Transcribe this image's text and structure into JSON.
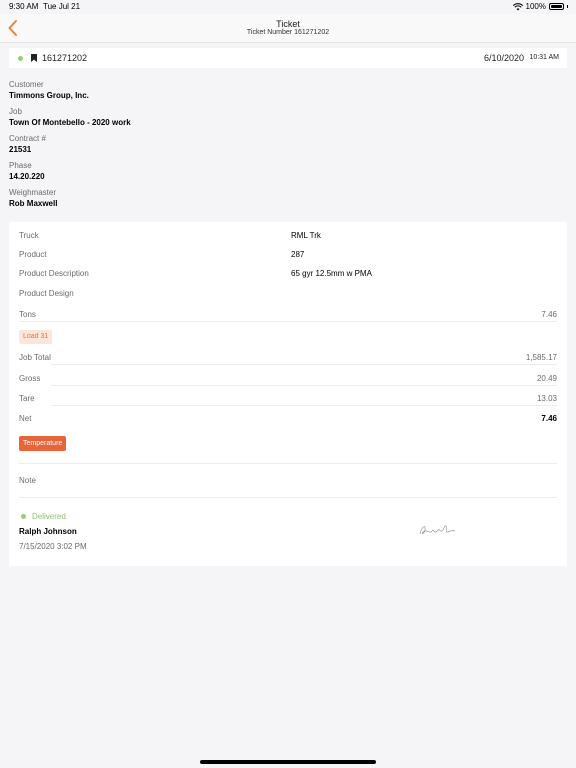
{
  "status_bar": {
    "time": "9:30 AM",
    "date": "Tue Jul 21",
    "battery": "100%"
  },
  "nav": {
    "title": "Ticket",
    "subtitle": "Ticket Number 161271202"
  },
  "ticket": {
    "number": "161271202",
    "date": "6/10/2020",
    "time": "10:31 AM"
  },
  "info": [
    {
      "label": "Customer",
      "value": "Timmons Group, Inc."
    },
    {
      "label": "Job",
      "value": "Town Of Montebello - 2020 work"
    },
    {
      "label": "Contract #",
      "value": "21531"
    },
    {
      "label": "Phase",
      "value": "14.20.220"
    },
    {
      "label": "Weighmaster",
      "value": "Rob Maxwell"
    }
  ],
  "details": {
    "truck_label": "Truck",
    "truck_value": "RML Trk",
    "product_label": "Product",
    "product_value": "287",
    "product_description_label": "Product Description",
    "product_description_value": "65 gyr 12.5mm w PMA",
    "product_design_label": "Product Design",
    "tons_label": "Tons",
    "tons_value": "7.46",
    "load_badge": "Load 31",
    "job_total_label": "Job Total",
    "job_total_value": "1,585.17",
    "gross_label": "Gross",
    "gross_value": "20.49",
    "tare_label": "Tare",
    "tare_value": "13.03",
    "net_label": "Net",
    "net_value": "7.46",
    "temperature_button": "Temperature",
    "note_label": "Note"
  },
  "delivery": {
    "status": "Delivered",
    "signer": "Ralph Johnson",
    "signed_at": "7/15/2020 3:02 PM"
  },
  "colors": {
    "accent": "#e8643a",
    "delivered": "#8fbf6f",
    "badge_bg": "#fde6d9"
  }
}
